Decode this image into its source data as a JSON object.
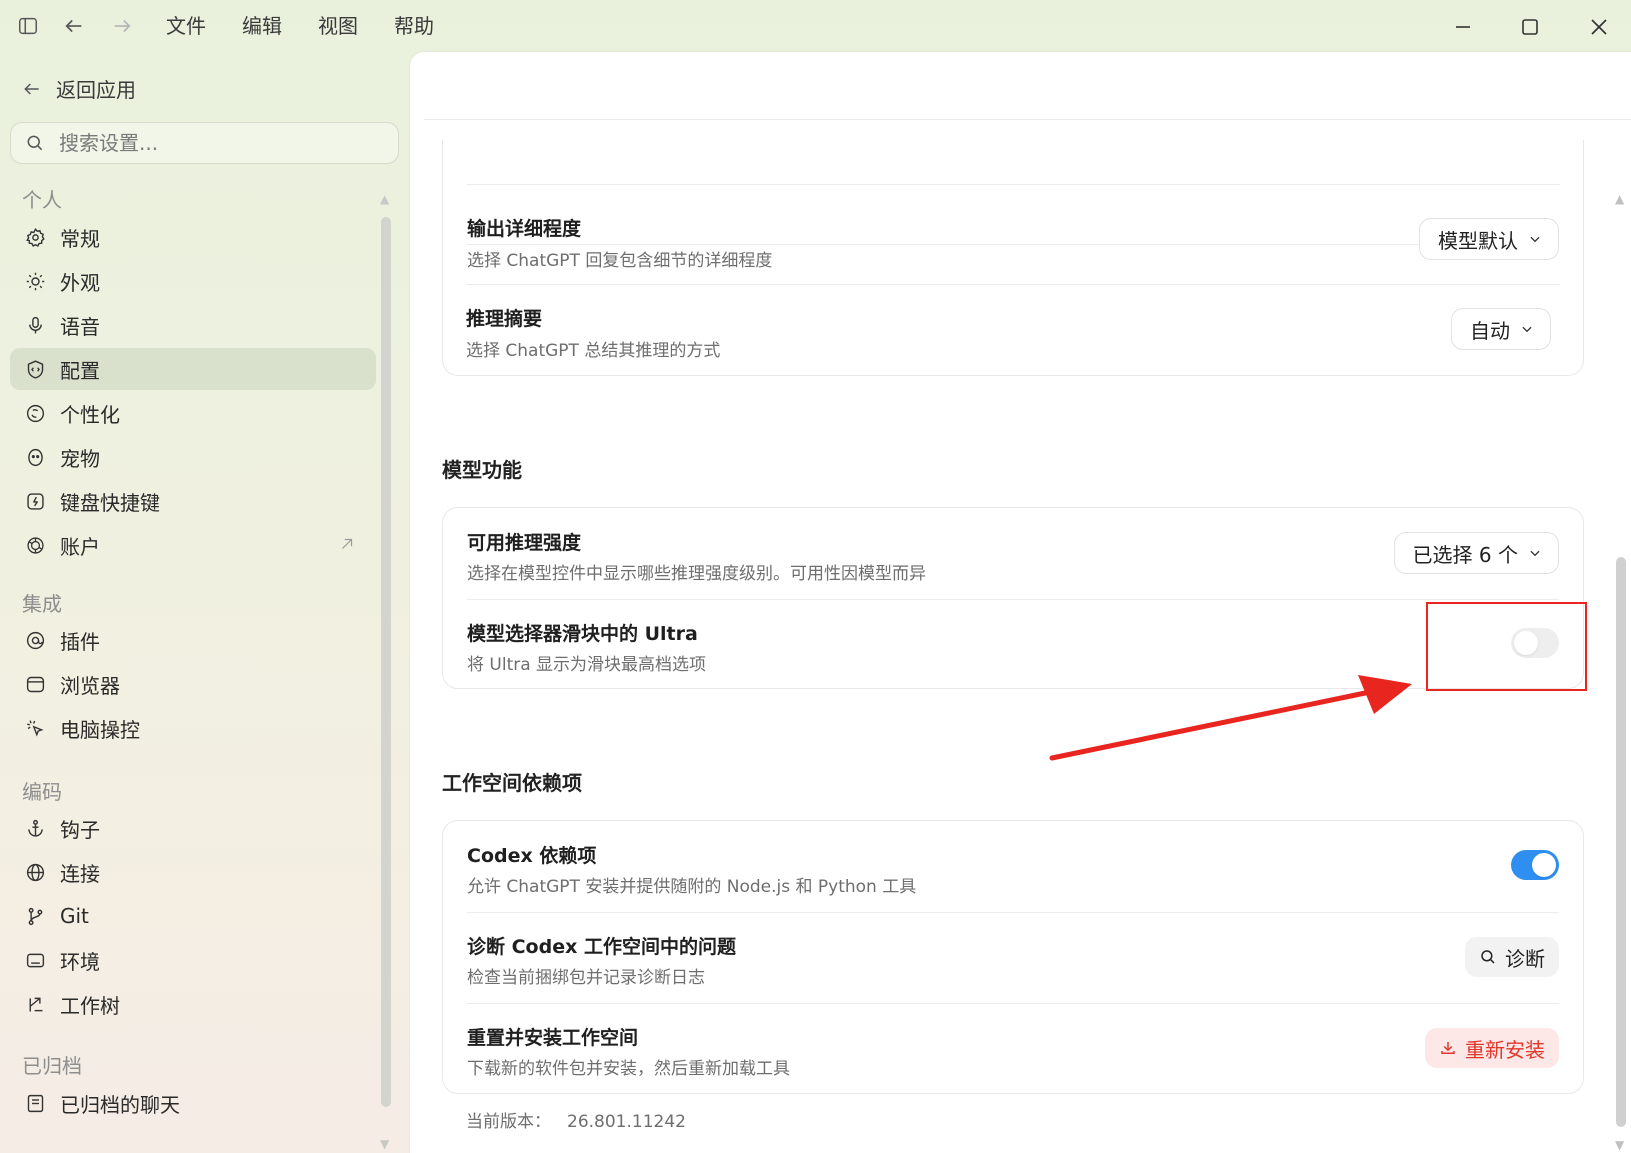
{
  "menu": [
    "文件",
    "编辑",
    "视图",
    "帮助"
  ],
  "sidebar": {
    "back_label": "返回应用",
    "search_placeholder": "搜索设置...",
    "sections": {
      "personal": "个人",
      "integrations": "集成",
      "coding": "编码",
      "archived": "已归档"
    },
    "items": [
      {
        "label": "常规",
        "icon": "gear-icon"
      },
      {
        "label": "外观",
        "icon": "sun-icon"
      },
      {
        "label": "语音",
        "icon": "microphone-icon"
      },
      {
        "label": "配置",
        "icon": "shield-icon",
        "active": true
      },
      {
        "label": "个性化",
        "icon": "personalize-icon"
      },
      {
        "label": "宠物",
        "icon": "pet-icon"
      },
      {
        "label": "键盘快捷键",
        "icon": "keyboard-shortcut-icon"
      },
      {
        "label": "账户",
        "icon": "openai-icon",
        "external": true
      },
      {
        "label": "插件",
        "icon": "plugin-icon"
      },
      {
        "label": "浏览器",
        "icon": "browser-icon"
      },
      {
        "label": "电脑操控",
        "icon": "cursor-click-icon"
      },
      {
        "label": "钩子",
        "icon": "anchor-icon"
      },
      {
        "label": "连接",
        "icon": "globe-icon"
      },
      {
        "label": "Git",
        "icon": "git-branch-icon"
      },
      {
        "label": "环境",
        "icon": "terminal-icon"
      },
      {
        "label": "工作树",
        "icon": "worktree-icon"
      },
      {
        "label": "已归档的聊天",
        "icon": "archive-icon"
      }
    ]
  },
  "main": {
    "output_detail": {
      "title": "输出详细程度",
      "desc": "选择 ChatGPT 回复包含细节的详细程度",
      "value": "模型默认"
    },
    "reasoning_summary": {
      "title": "推理摘要",
      "desc": "选择 ChatGPT 总结其推理的方式",
      "value": "自动"
    },
    "model_features": {
      "title": "模型功能",
      "available_effort": {
        "title": "可用推理强度",
        "desc": "选择在模型控件中显示哪些推理强度级别。可用性因模型而异",
        "value": "已选择 6 个"
      },
      "ultra_slider": {
        "title": "模型选择器滑块中的 Ultra",
        "desc": "将 Ultra 显示为滑块最高档选项",
        "enabled": false
      }
    },
    "workspace_deps": {
      "title": "工作空间依赖项",
      "codex_deps": {
        "title": "Codex 依赖项",
        "desc": "允许 ChatGPT 安装并提供随附的 Node.js 和 Python 工具",
        "enabled": true
      },
      "diagnose": {
        "title": "诊断 Codex 工作空间中的问题",
        "desc": "检查当前捆绑包并记录诊断日志",
        "button": "诊断"
      },
      "reinstall": {
        "title": "重置并安装工作空间",
        "desc": "下载新的软件包并安装，然后重新加载工具",
        "button": "重新安装"
      }
    },
    "version_label": "当前版本：",
    "version_value": "26.801.11242"
  },
  "colors": {
    "accent": "#2e8ff0",
    "danger": "#e0372b",
    "annotation": "#e8251f"
  }
}
